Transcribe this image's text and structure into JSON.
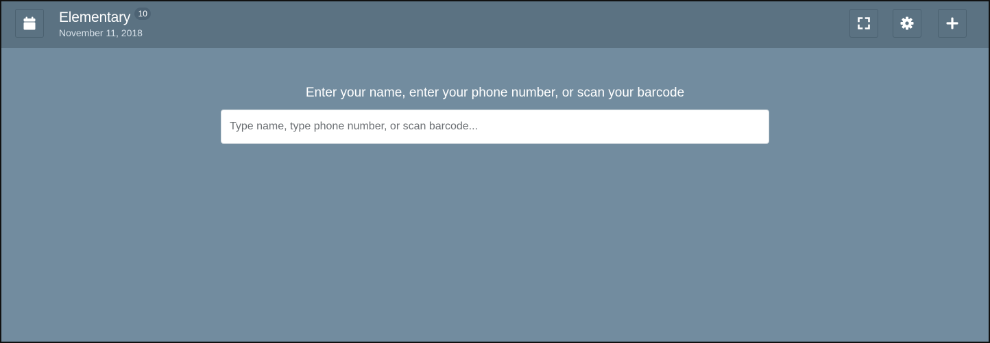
{
  "header": {
    "title": "Elementary",
    "badge_count": "10",
    "date": "November 11, 2018",
    "buttons": [
      {
        "icon": "calendar-icon"
      },
      {
        "icon": "fullscreen-icon"
      },
      {
        "icon": "gear-icon"
      },
      {
        "icon": "plus-icon"
      }
    ]
  },
  "main": {
    "prompt": "Enter your name, enter your phone number, or scan your barcode",
    "search": {
      "value": "",
      "placeholder": "Type name, type phone number, or scan barcode..."
    }
  },
  "colors": {
    "background": "#728c9f",
    "header": "#5b7282",
    "badge": "#4d6374",
    "input_background": "#ffffff"
  }
}
